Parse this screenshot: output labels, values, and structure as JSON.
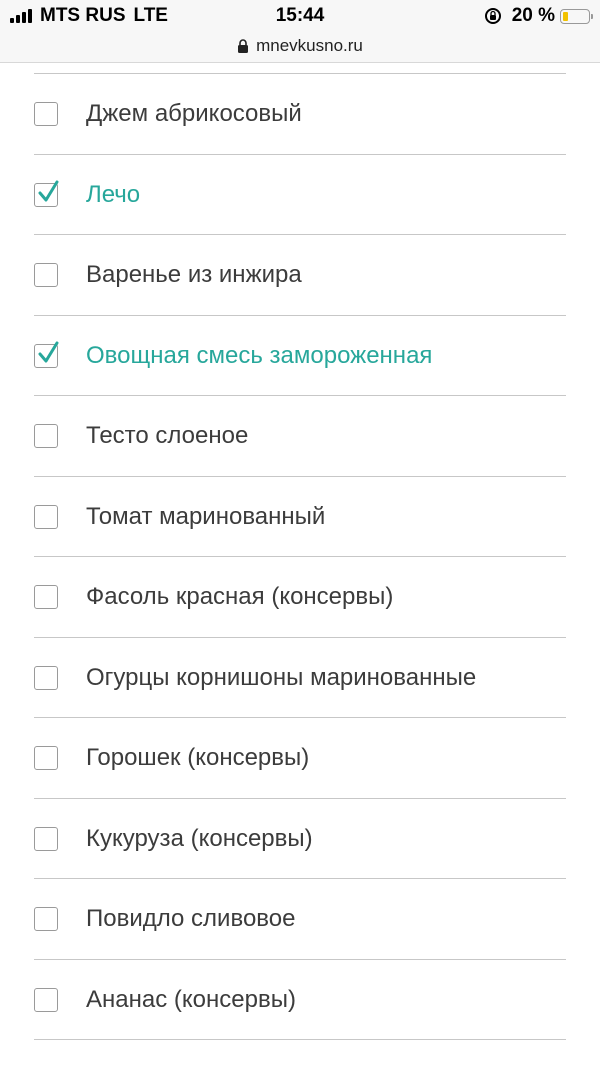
{
  "status_bar": {
    "carrier": "MTS RUS",
    "network": "LTE",
    "time": "15:44",
    "battery_percent": "20 %",
    "battery_level": 0.2,
    "battery_color": "#f2c200"
  },
  "browser": {
    "url": "mnevkusno.ru",
    "lock_icon": "lock-icon"
  },
  "accent_color": "#27a79b",
  "shopping_list": {
    "items": [
      {
        "label": "Джем абрикосовый",
        "checked": false
      },
      {
        "label": "Лечо",
        "checked": true
      },
      {
        "label": "Варенье из инжира",
        "checked": false
      },
      {
        "label": "Овощная смесь замороженная",
        "checked": true
      },
      {
        "label": "Тесто слоеное",
        "checked": false
      },
      {
        "label": "Томат маринованный",
        "checked": false
      },
      {
        "label": "Фасоль красная (консервы)",
        "checked": false
      },
      {
        "label": "Огурцы корнишоны маринованные",
        "checked": false
      },
      {
        "label": "Горошек (консервы)",
        "checked": false
      },
      {
        "label": "Кукуруза (консервы)",
        "checked": false
      },
      {
        "label": "Повидло сливовое",
        "checked": false
      },
      {
        "label": "Ананас (консервы)",
        "checked": false
      }
    ]
  }
}
